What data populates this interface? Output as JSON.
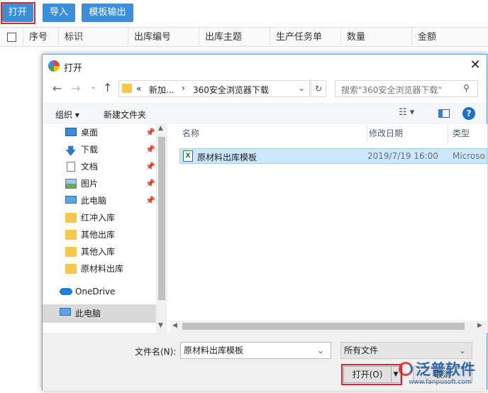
{
  "toolbar": {
    "open": "打开",
    "import": "导入",
    "template_export": "模板输出"
  },
  "grid": {
    "columns": [
      "序号",
      "标识",
      "出库编号",
      "出库主题",
      "生产任务单",
      "数量",
      "金额"
    ]
  },
  "dialog": {
    "title": "打开",
    "address": {
      "overflow": "«",
      "segment1": "新加...",
      "separator": "›",
      "segment2": "360安全浏览器下载"
    },
    "search_placeholder": "搜索\"360安全浏览器下载\"",
    "organize": "组织 ▾",
    "new_folder": "新建文件夹",
    "nav_items": [
      {
        "label": "桌面",
        "icon": "desktop-icon",
        "pinned": true
      },
      {
        "label": "下载",
        "icon": "download-icon",
        "pinned": true
      },
      {
        "label": "文档",
        "icon": "document-icon",
        "pinned": true
      },
      {
        "label": "图片",
        "icon": "picture-icon",
        "pinned": true
      },
      {
        "label": "此电脑",
        "icon": "computer-icon",
        "pinned": true
      },
      {
        "label": "红冲入库",
        "icon": "folder-icon",
        "pinned": false
      },
      {
        "label": "其他出库",
        "icon": "folder-icon",
        "pinned": false
      },
      {
        "label": "其他入库",
        "icon": "folder-icon",
        "pinned": false
      },
      {
        "label": "原材料出库",
        "icon": "folder-icon",
        "pinned": false
      },
      {
        "label": "OneDrive",
        "icon": "cloud-icon",
        "pinned": false
      },
      {
        "label": "此电脑",
        "icon": "computer-icon",
        "pinned": false
      }
    ],
    "columns": {
      "name": "名称",
      "modified": "修改日期",
      "type": "类型"
    },
    "files": [
      {
        "name": "原材料出库模板",
        "modified": "2019/7/19 16:00",
        "type": "Microso"
      }
    ],
    "filename_label": "文件名(N):",
    "filename_value": "原材料出库模板",
    "filter_value": "所有文件",
    "open_button": "打开(O)",
    "cancel_button": "取消"
  },
  "watermark": {
    "brand": "泛普软件",
    "url": "www.fanpusoft.com"
  },
  "colors": {
    "toolbar_button": "#3b8fd9",
    "highlight": "#e0262b",
    "selected_row": "#cce8ff"
  }
}
